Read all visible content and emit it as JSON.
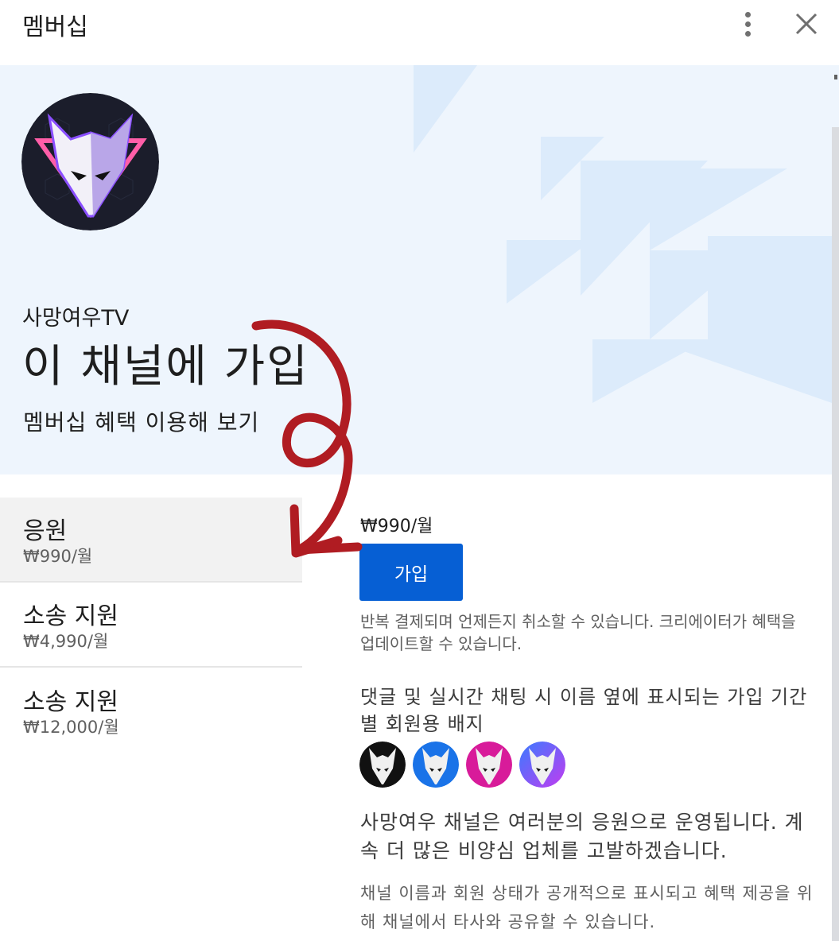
{
  "header": {
    "title": "멤버십",
    "more_icon": "more-vertical-icon",
    "close_icon": "close-icon"
  },
  "banner": {
    "channel_name": "사망여우TV",
    "title": "이 채널에 가입",
    "subtitle": "멤버십 혜택 이용해 보기",
    "avatar_icon": "white-fox-mask-logo"
  },
  "tiers": [
    {
      "name": "응원",
      "price": "₩990/월",
      "selected": true
    },
    {
      "name": "소송 지원",
      "price": "₩4,990/월",
      "selected": false
    },
    {
      "name": "소송 지원",
      "price": "₩12,000/월",
      "selected": false
    }
  ],
  "detail": {
    "price": "₩990/월",
    "join_label": "가입",
    "billing_note": "반복 결제되며 언제든지 취소할 수 있습니다. 크리에이터가 혜택을 업데이트할 수 있습니다.",
    "benefit_text": "댓글 및 실시간 채팅 시 이름 옆에 표시되는 가입 기간별 회원용 배지",
    "badges": [
      {
        "icon": "fox-badge-black",
        "color": "#111111"
      },
      {
        "icon": "fox-badge-blue",
        "color": "#1a73e8"
      },
      {
        "icon": "fox-badge-magenta",
        "color": "#d81b9a"
      },
      {
        "icon": "fox-badge-purple",
        "color": "#7b45e8"
      }
    ],
    "support_text": "사망여우 채널은 여러분의 응원으로 운영됩니다. 계속 더 많은 비양심 업체를 고발하겠습니다.",
    "disclaimer": "채널 이름과 회원 상태가 공개적으로 표시되고 혜택 제공을 위해 채널에서 타사와 공유할 수 있습니다."
  },
  "colors": {
    "banner_bg": "#eef5fd",
    "accent": "#065fd4",
    "selected_tier_bg": "#f2f2f2",
    "annotation_arrow": "#b01c22"
  }
}
